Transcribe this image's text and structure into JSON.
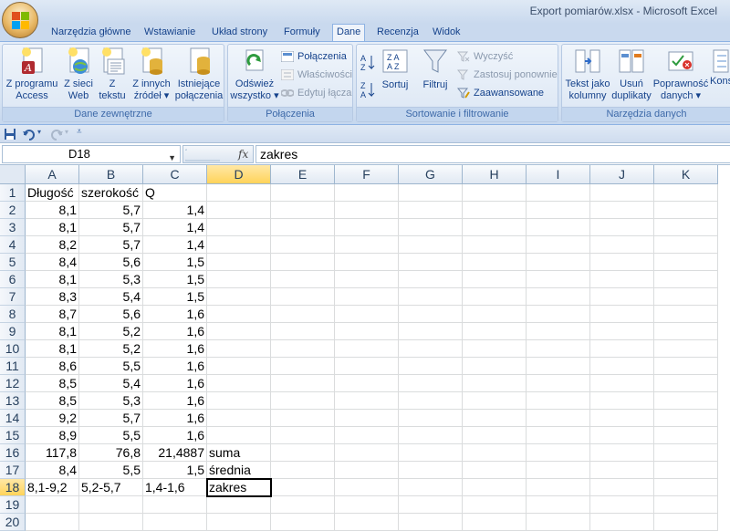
{
  "window": {
    "title": "Export pomiarów.xlsx - Microsoft Excel"
  },
  "tabs": [
    {
      "label": "Narzędzia główne",
      "active": false
    },
    {
      "label": "Wstawianie",
      "active": false
    },
    {
      "label": "Układ strony",
      "active": false
    },
    {
      "label": "Formuły",
      "active": false
    },
    {
      "label": "Dane",
      "active": true
    },
    {
      "label": "Recenzja",
      "active": false
    },
    {
      "label": "Widok",
      "active": false
    }
  ],
  "ribbon": {
    "external": {
      "label": "Dane zewnętrzne",
      "access_l1": "Z programu",
      "access_l2": "Access",
      "web_l1": "Z sieci",
      "web_l2": "Web",
      "text_l1": "Z",
      "text_l2": "tekstu",
      "other_l1": "Z innych",
      "other_l2": "źródeł ▾",
      "existing_l1": "Istniejące",
      "existing_l2": "połączenia"
    },
    "connections": {
      "label": "Połączenia",
      "refresh_l1": "Odśwież",
      "refresh_l2": "wszystko ▾",
      "conn": "Połączenia",
      "props": "Właściwości",
      "editlinks": "Edytuj łącza"
    },
    "sort": {
      "label": "Sortowanie i filtrowanie",
      "sort": "Sortuj",
      "filter": "Filtruj",
      "clear": "Wyczyść",
      "reapply": "Zastosuj ponownie",
      "advanced": "Zaawansowane"
    },
    "tools": {
      "label": "Narzędzia danych",
      "t2c_l1": "Tekst jako",
      "t2c_l2": "kolumny",
      "dup_l1": "Usuń",
      "dup_l2": "duplikaty",
      "valid_l1": "Poprawność",
      "valid_l2": "danych ▾",
      "consol_l1": "Konso"
    }
  },
  "formula_bar": {
    "name_box": "D18",
    "fx": "fx",
    "content": "zakres"
  },
  "columns": [
    "A",
    "B",
    "C",
    "D",
    "E",
    "F",
    "G",
    "H",
    "I",
    "J",
    "K"
  ],
  "rows": [
    [
      "Długość",
      "szerokość",
      "Q",
      ""
    ],
    [
      "8,1",
      "5,7",
      "1,4",
      ""
    ],
    [
      "8,1",
      "5,7",
      "1,4",
      ""
    ],
    [
      "8,2",
      "5,7",
      "1,4",
      ""
    ],
    [
      "8,4",
      "5,6",
      "1,5",
      ""
    ],
    [
      "8,1",
      "5,3",
      "1,5",
      ""
    ],
    [
      "8,3",
      "5,4",
      "1,5",
      ""
    ],
    [
      "8,7",
      "5,6",
      "1,6",
      ""
    ],
    [
      "8,1",
      "5,2",
      "1,6",
      ""
    ],
    [
      "8,1",
      "5,2",
      "1,6",
      ""
    ],
    [
      "8,6",
      "5,5",
      "1,6",
      ""
    ],
    [
      "8,5",
      "5,4",
      "1,6",
      ""
    ],
    [
      "8,5",
      "5,3",
      "1,6",
      ""
    ],
    [
      "9,2",
      "5,7",
      "1,6",
      ""
    ],
    [
      "8,9",
      "5,5",
      "1,6",
      ""
    ],
    [
      "117,8",
      "76,8",
      "21,4887",
      "suma"
    ],
    [
      "8,4",
      "5,5",
      "1,5",
      "średnia"
    ],
    [
      "8,1-9,2",
      "5,2-5,7",
      "1,4-1,6",
      "zakres"
    ],
    [
      "",
      "",
      "",
      ""
    ],
    [
      "",
      "",
      "",
      ""
    ]
  ],
  "row_numbers": [
    "1",
    "2",
    "3",
    "4",
    "5",
    "6",
    "7",
    "8",
    "9",
    "10",
    "11",
    "12",
    "13",
    "14",
    "15",
    "16",
    "17",
    "18",
    "19",
    "20"
  ],
  "selected": {
    "col": "D",
    "row": "18"
  }
}
